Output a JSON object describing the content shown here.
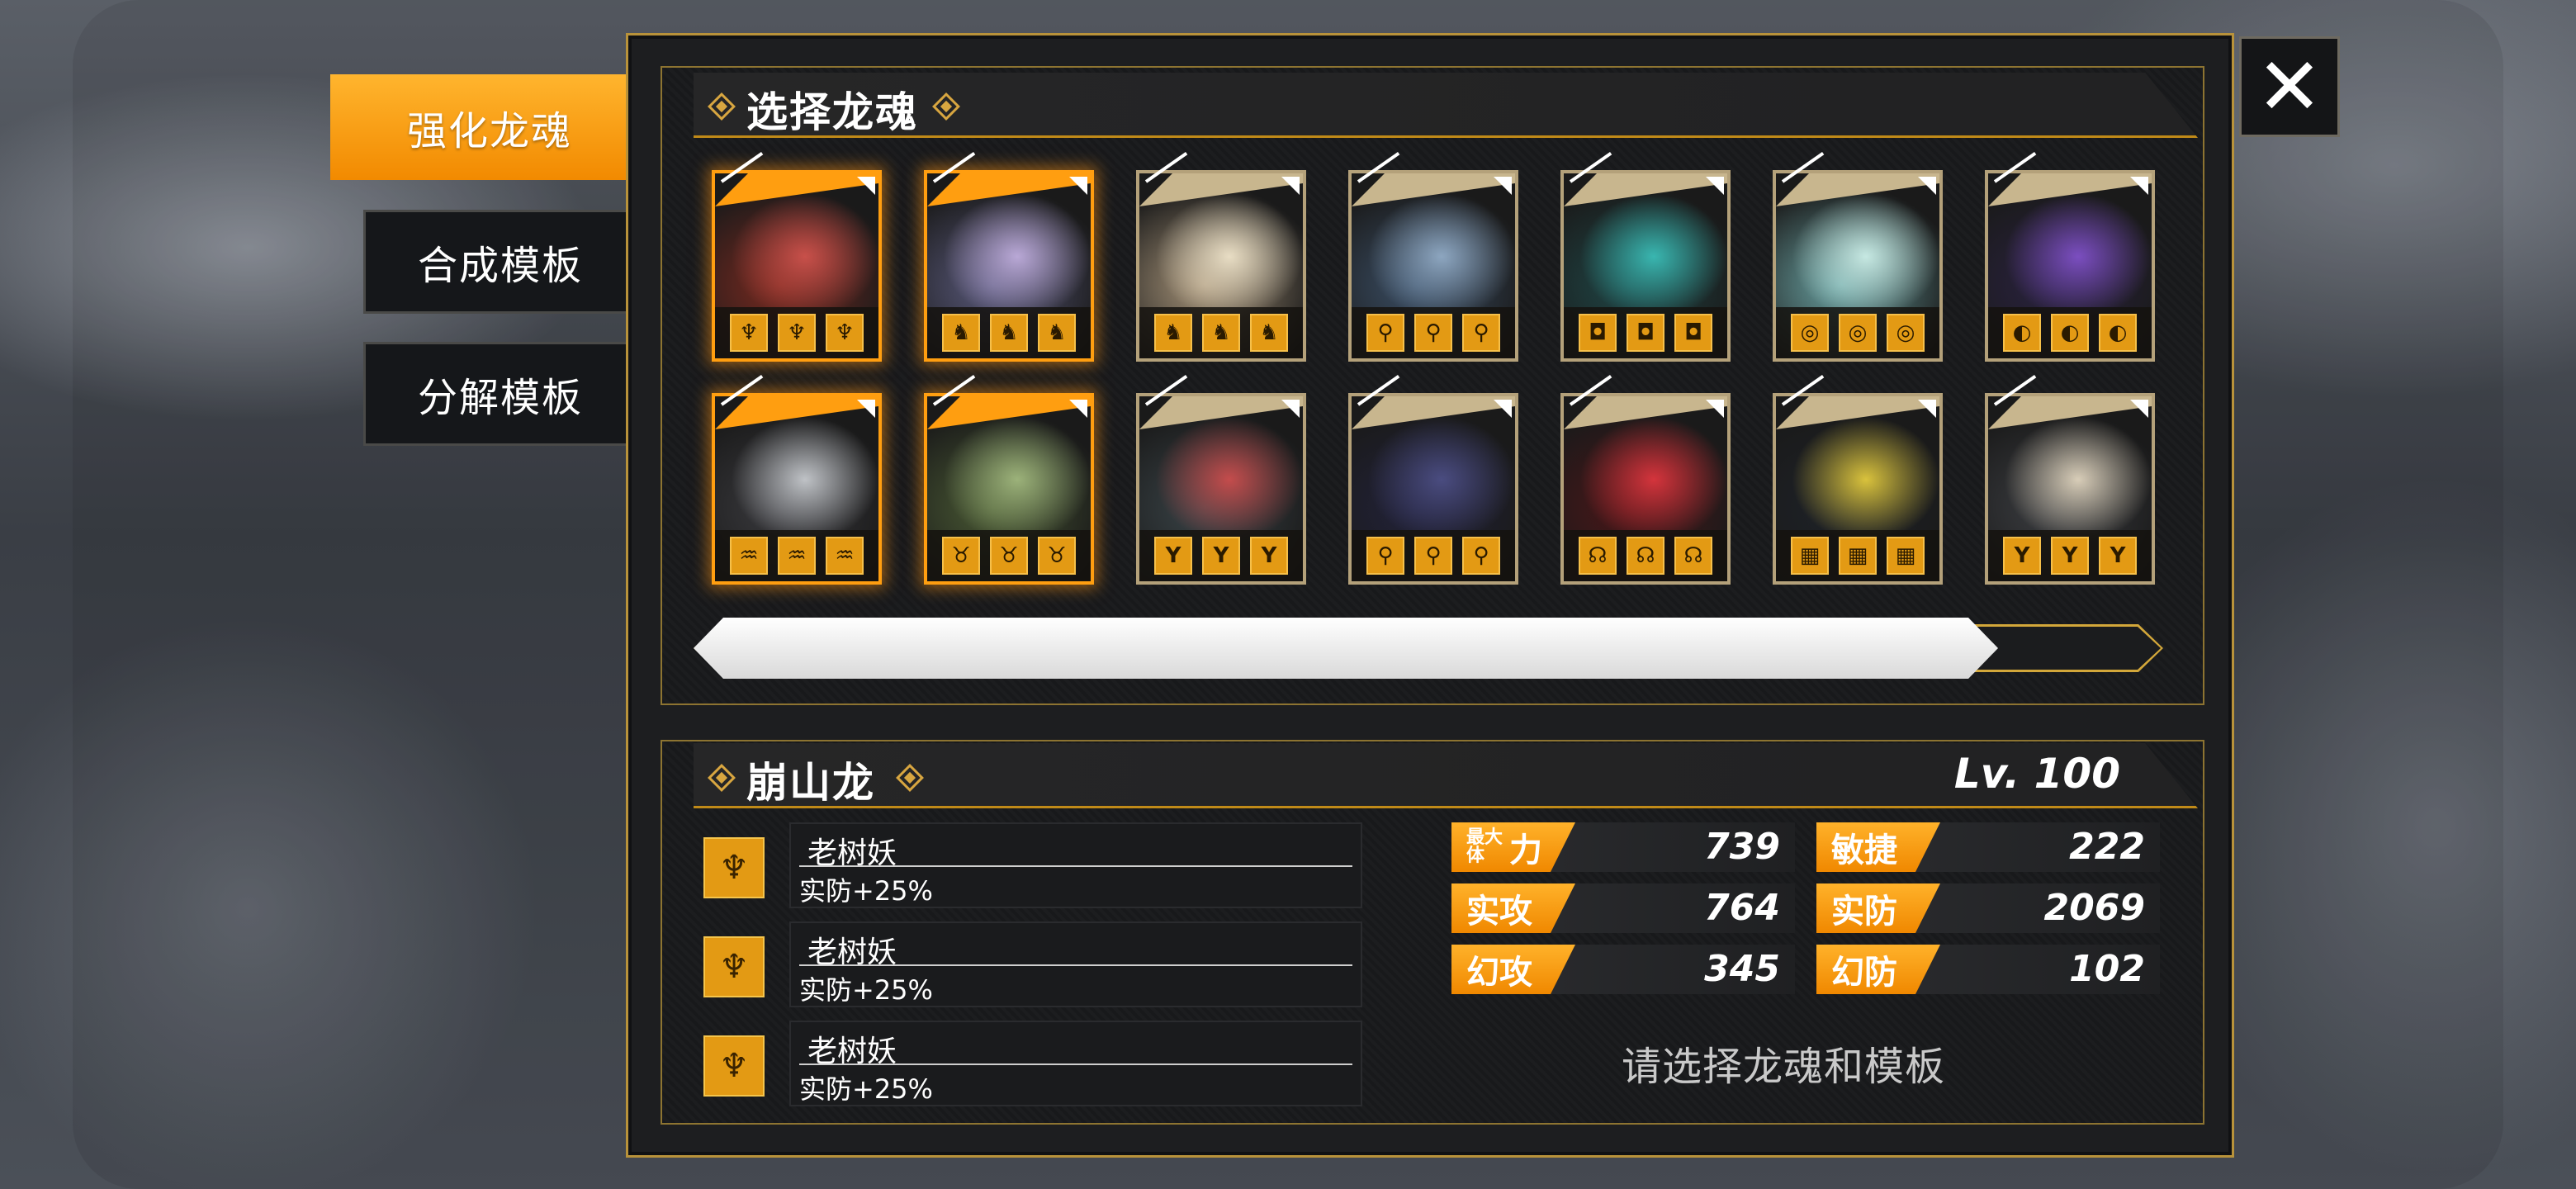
{
  "tabs": [
    {
      "label": "强化龙魂",
      "active": true
    },
    {
      "label": "合成模板",
      "active": false
    },
    {
      "label": "分解模板",
      "active": false
    }
  ],
  "select_section": {
    "title": "选择龙魂"
  },
  "close_icon": "close-x-icon",
  "cards": [
    {
      "selected": true,
      "palette": [
        "#7a2a20",
        "#c8504a"
      ],
      "slots": [
        "♆",
        "♆",
        "♆"
      ]
    },
    {
      "selected": true,
      "palette": [
        "#5a5a7c",
        "#b9a8d6"
      ],
      "slots": [
        "♞",
        "♞",
        "♞"
      ]
    },
    {
      "selected": false,
      "palette": [
        "#a8957a",
        "#e8ddc4"
      ],
      "slots": [
        "♞",
        "♞",
        "♞"
      ]
    },
    {
      "selected": false,
      "palette": [
        "#3b4f66",
        "#8da6c0"
      ],
      "slots": [
        "⚲",
        "⚲",
        "⚲"
      ]
    },
    {
      "selected": false,
      "palette": [
        "#1f4646",
        "#39b6b0"
      ],
      "slots": [
        "◘",
        "◘",
        "◘"
      ]
    },
    {
      "selected": false,
      "palette": [
        "#6ba4a4",
        "#c6e8e2"
      ],
      "slots": [
        "◎",
        "◎",
        "◎"
      ]
    },
    {
      "selected": false,
      "palette": [
        "#2a2240",
        "#7b4ec0"
      ],
      "slots": [
        "◐",
        "◐",
        "◐"
      ]
    },
    {
      "selected": true,
      "palette": [
        "#3a3a3e",
        "#bfc2c6"
      ],
      "slots": [
        "♒",
        "♒",
        "♒"
      ]
    },
    {
      "selected": true,
      "palette": [
        "#4a5a34",
        "#9cb27a"
      ],
      "slots": [
        "♉",
        "♉",
        "♉"
      ]
    },
    {
      "selected": false,
      "palette": [
        "#3a4448",
        "#c44c4c"
      ],
      "slots": [
        "Y",
        "Y",
        "Y"
      ]
    },
    {
      "selected": false,
      "palette": [
        "#22223a",
        "#4a4c80"
      ],
      "slots": [
        "⚲",
        "⚲",
        "⚲"
      ]
    },
    {
      "selected": false,
      "palette": [
        "#4a1618",
        "#d4343c"
      ],
      "slots": [
        "☊",
        "☊",
        "☊"
      ]
    },
    {
      "selected": false,
      "palette": [
        "#1e2228",
        "#d9c23c"
      ],
      "slots": [
        "▦",
        "▦",
        "▦"
      ]
    },
    {
      "selected": false,
      "palette": [
        "#3c3e42",
        "#d8cdb8"
      ],
      "slots": [
        "Y",
        "Y",
        "Y"
      ]
    }
  ],
  "scroll": {
    "position": 0.0,
    "visible_fraction": 0.89
  },
  "detail": {
    "name": "崩山龙",
    "level": "Lv. 100",
    "skills": [
      {
        "name": "老树妖",
        "effect": "实防+25%",
        "icon": "♆"
      },
      {
        "name": "老树妖",
        "effect": "实防+25%",
        "icon": "♆"
      },
      {
        "name": "老树妖",
        "effect": "实防+25%",
        "icon": "♆"
      }
    ],
    "stats": [
      {
        "small": "最大体",
        "label": "力",
        "value": "739"
      },
      {
        "small": "",
        "label": "敏捷",
        "value": "222"
      },
      {
        "small": "",
        "label": "实攻",
        "value": "764"
      },
      {
        "small": "",
        "label": "实防",
        "value": "2069"
      },
      {
        "small": "",
        "label": "幻攻",
        "value": "345"
      },
      {
        "small": "",
        "label": "幻防",
        "value": "102"
      }
    ],
    "prompt": "请选择龙魂和模板"
  },
  "colors": {
    "accent": "#f5960a",
    "gold_border": "#b8923a"
  }
}
